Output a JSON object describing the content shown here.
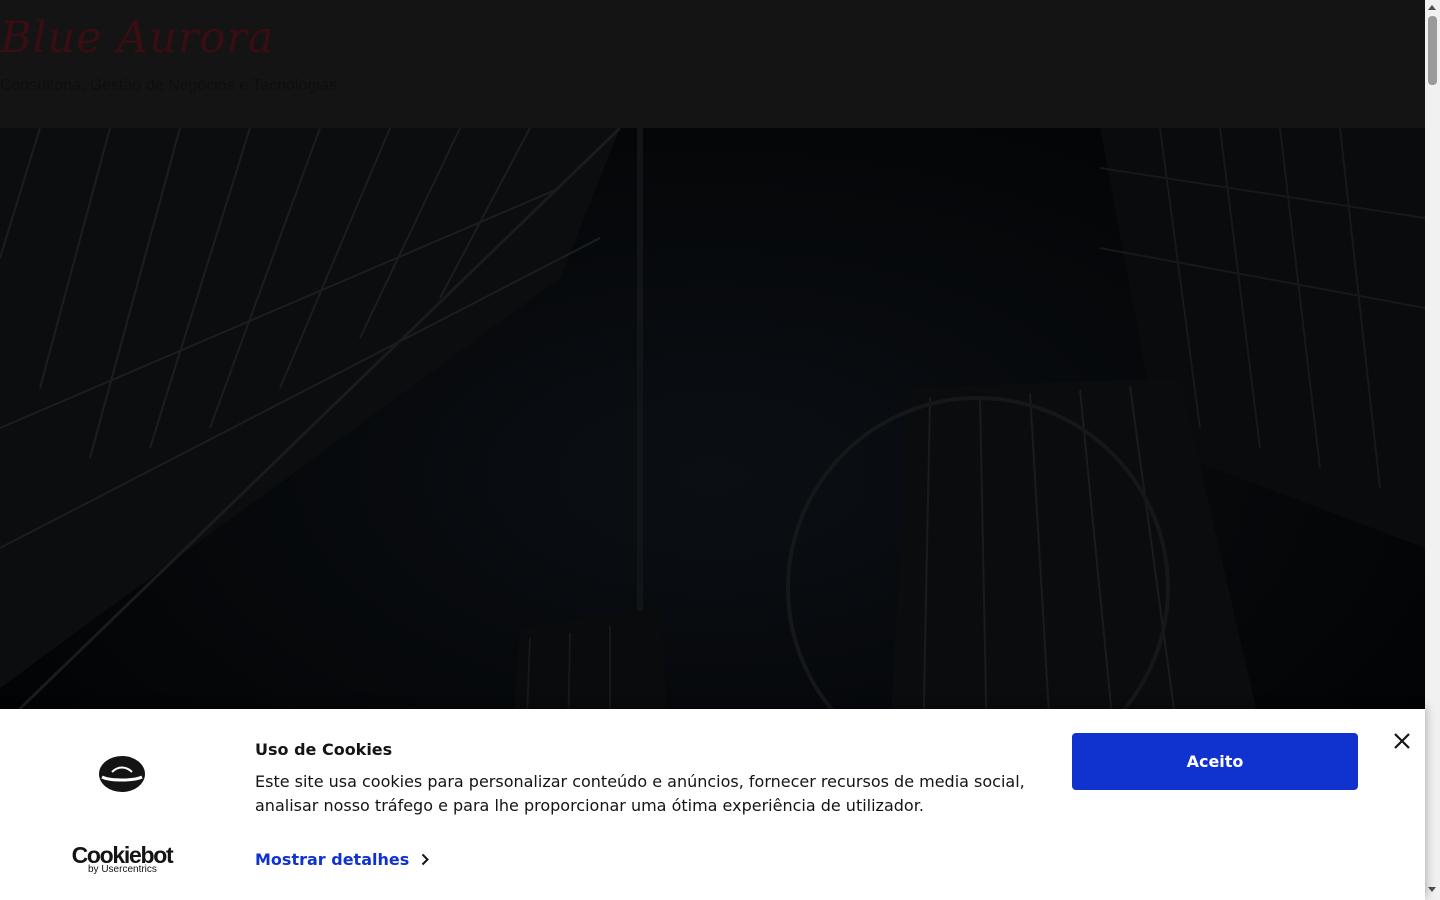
{
  "header": {
    "site_title": "Blue Aurora",
    "tagline": "Consultoria, Gestão de Negócios e Tecnologias"
  },
  "hero": {
    "image": "dark-city-skyscrapers-background"
  },
  "cookie_banner": {
    "brand_name": "Cookiebot",
    "brand_sub": "by Usercentrics",
    "title": "Uso de Cookies",
    "text": "Este site usa cookies para personalizar conteúdo e anúncios, fornecer recursos de media social, analisar nosso tráfego e para lhe proporcionar uma ótima experiência de utilizador.",
    "details_label": "Mostrar detalhes",
    "accept_label": "Aceito",
    "close_icon": "close-icon",
    "accent_color": "#1032cf"
  },
  "colors": {
    "header_bg": "#141414",
    "hero_bg": "#040608",
    "title_color": "#3a0d12"
  }
}
